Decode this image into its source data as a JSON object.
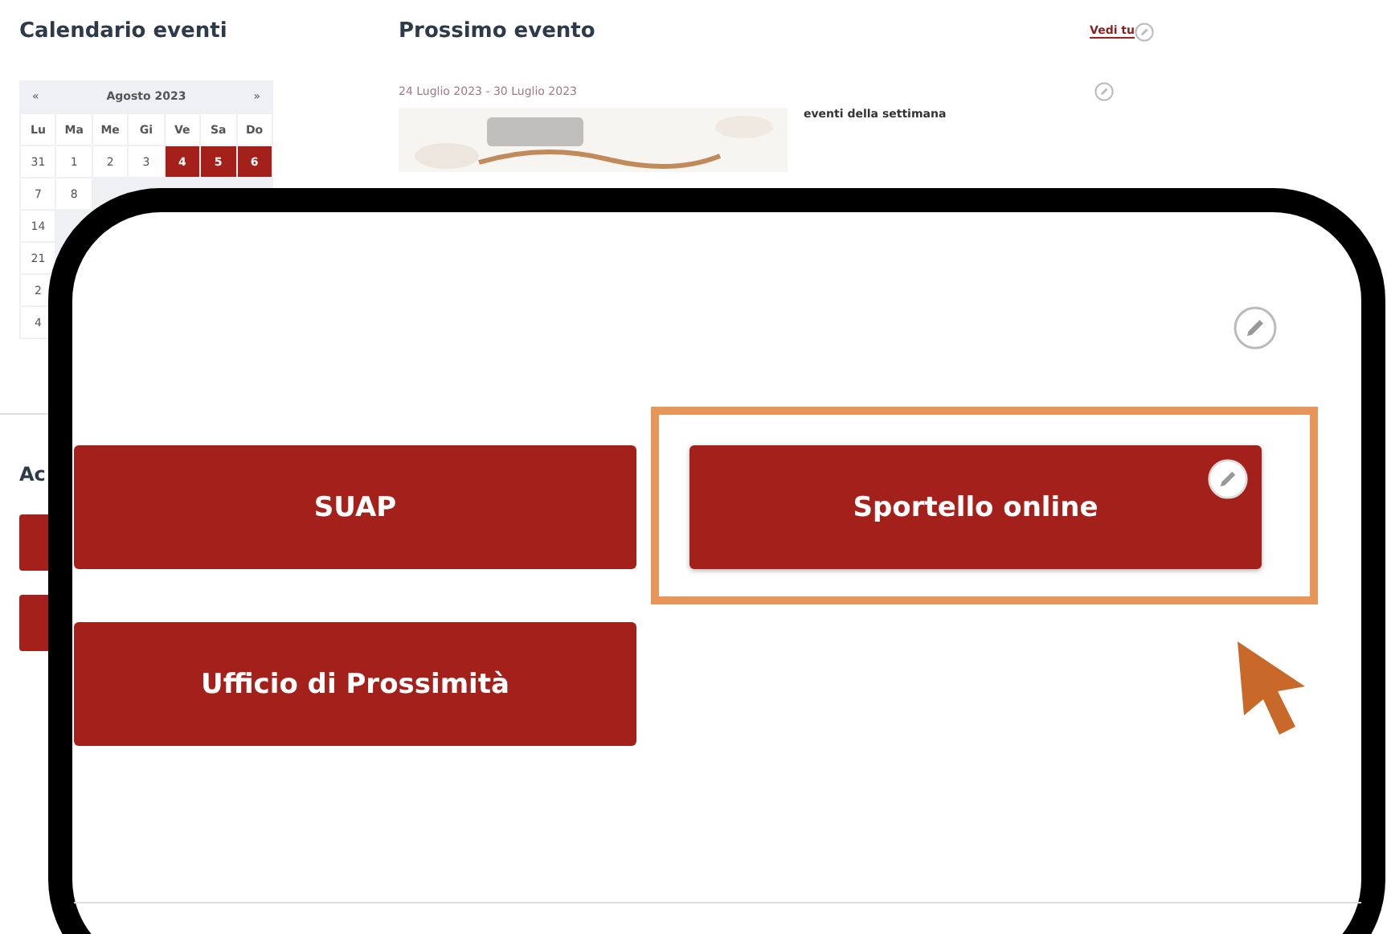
{
  "calendar": {
    "title": "Calendario eventi",
    "prev": "«",
    "month": "Agosto 2023",
    "next": "»",
    "weekdays": [
      "Lu",
      "Ma",
      "Me",
      "Gi",
      "Ve",
      "Sa",
      "Do"
    ],
    "weeks": [
      [
        {
          "day": "31",
          "event": false
        },
        {
          "day": "1",
          "event": false
        },
        {
          "day": "2",
          "event": false
        },
        {
          "day": "3",
          "event": false
        },
        {
          "day": "4",
          "event": true
        },
        {
          "day": "5",
          "event": true
        },
        {
          "day": "6",
          "event": true
        }
      ],
      [
        {
          "day": "7",
          "event": false
        },
        {
          "day": "8",
          "event": false
        }
      ],
      [
        {
          "day": "14",
          "event": false
        }
      ],
      [
        {
          "day": "21",
          "event": false
        }
      ],
      [
        {
          "day": "2",
          "event": false
        }
      ],
      [
        {
          "day": "4",
          "event": false
        }
      ]
    ]
  },
  "next_event": {
    "title": "Prossimo evento",
    "link": "Vedi tu",
    "date": "24 Luglio 2023 - 30 Luglio 2023",
    "description": "eventi della settimana"
  },
  "access": {
    "title": "Ac"
  },
  "zoom_panel": {
    "buttons": [
      {
        "label": "SUAP",
        "highlighted": false,
        "editable": false
      },
      {
        "label": "Sportello online",
        "highlighted": true,
        "editable": true
      },
      {
        "label": "Ufficio di Prossimità",
        "highlighted": false,
        "editable": false
      }
    ]
  }
}
